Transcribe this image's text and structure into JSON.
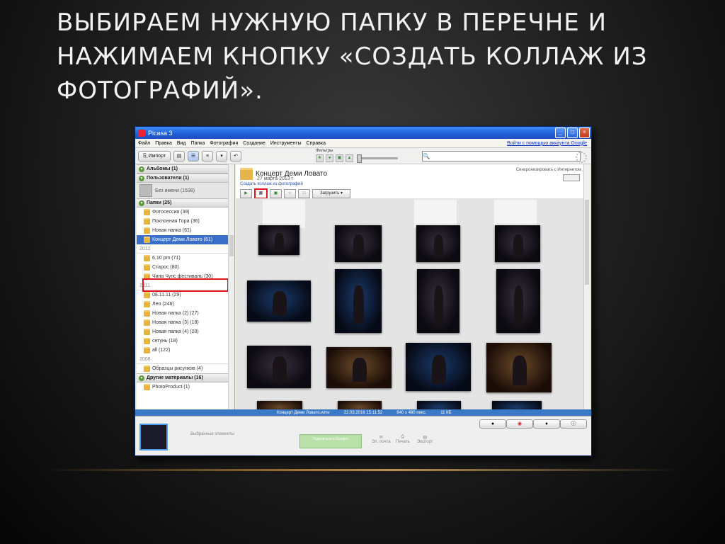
{
  "slide": {
    "title": "Выбираем нужную папку в перечне и нажимаем кнопку «Создать коллаж из фотографий»."
  },
  "window": {
    "title": "Picasa 3",
    "controls": [
      "_",
      "□",
      "×"
    ]
  },
  "menu": {
    "items": [
      "Файл",
      "Правка",
      "Вид",
      "Папка",
      "Фотография",
      "Создание",
      "Инструменты",
      "Справка"
    ],
    "signin": "Войти с помощью аккаунта Google"
  },
  "toolbar": {
    "import_label": "Импорт",
    "filters_label": "Фильтры",
    "search_placeholder": ""
  },
  "sidebar": {
    "albums": "Альбомы (1)",
    "users": "Пользователи (1)",
    "user_name": "Без имени (1598)",
    "folders": "Папки (25)",
    "folders_2013": [
      "Фотосессия (39)",
      "Поклонная Гора (36)",
      "Новая папка (61)",
      "Концерт Деми Ловато (61)"
    ],
    "year_2012": "2012",
    "folders_2012": [
      "6.10 pm (71)",
      "Старос (80)",
      "Чипа Чупс фестиваль (30)"
    ],
    "year_2011": "2011",
    "folders_2011": [
      "08.11.11 (29)",
      "Лео (246)",
      "Новая папка (2) (27)",
      "Новая папка (3) (18)",
      "Новая папка (4) (20)",
      "сетунь (18)",
      "all (122)"
    ],
    "year_2008": "2008",
    "folders_2008": [
      "Образцы рисунков (4)"
    ],
    "other": "Другие материалы (16)",
    "other_items": [
      "PhotoProduct (1)"
    ]
  },
  "main": {
    "folder_title": "Концерт Деми Ловато",
    "folder_date": "27 марта 2013 г",
    "create_collage_link": "Создать коллаж из фотографий",
    "sync_label": "Синхронизировать с Интернетом",
    "upload_label": "Загрузить"
  },
  "status": {
    "file": "Концерт Деми Ловато.wmv",
    "date": "22.03.2016 15:11:52",
    "size": "640 x 480 пикс.",
    "kb": "11 КБ"
  },
  "tray": {
    "selected_label": "Выбранные элементы",
    "share_button": "Поделиться в Google+",
    "email_label": "Эл. почта",
    "print_label": "Печать",
    "export_label": "Экспорт"
  },
  "colors": {
    "highlight": "#e2141c",
    "titlebar": "#1f5fd8",
    "status": "#3a79c6"
  }
}
